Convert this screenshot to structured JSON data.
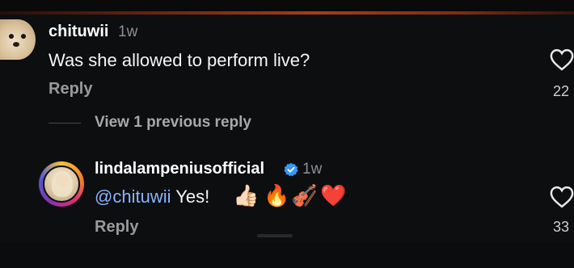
{
  "comments": [
    {
      "username": "chituwii",
      "time": "1w",
      "text": "Was she allowed to perform live?",
      "reply_label": "Reply",
      "likes": "22",
      "avatar_icon": "dog-avatar"
    }
  ],
  "thread": {
    "view_previous_label": "View 1 previous reply"
  },
  "replies": [
    {
      "username": "lindalampeniusofficial",
      "verified": true,
      "time": "1w",
      "mention": "@chituwii",
      "text": "Yes!",
      "emojis": [
        "👍🏻",
        "🔥",
        "🎻",
        "❤️"
      ],
      "reply_label": "Reply",
      "likes": "33",
      "avatar_icon": "profile-photo-avatar"
    }
  ],
  "colors": {
    "background": "#0d0e10",
    "verified_badge": "#3897f0",
    "mention": "#8ab4ff",
    "secondary_text": "#8e8e8e"
  }
}
